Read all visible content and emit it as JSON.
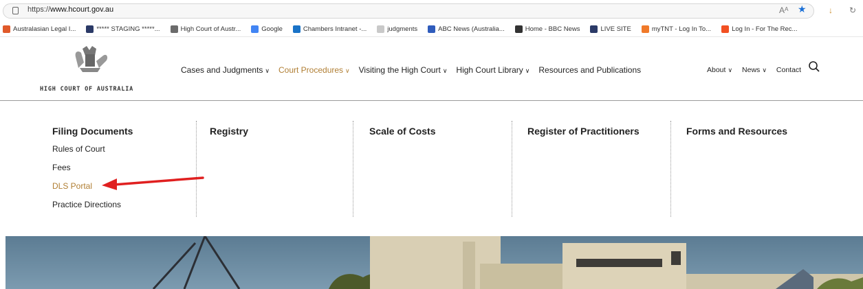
{
  "browser": {
    "url_prefix": "https://",
    "url_host": "www.hcourt.gov.au"
  },
  "bookmarks": [
    {
      "label": "Australasian Legal I...",
      "color": "#e05a2a"
    },
    {
      "label": "***** STAGING *****...",
      "color": "#2b3a67"
    },
    {
      "label": "High Court of Austr...",
      "color": "#6b6b6b"
    },
    {
      "label": "Google",
      "color": "#4285f4"
    },
    {
      "label": "Chambers Intranet -...",
      "color": "#1a73c7"
    },
    {
      "label": "judgments",
      "color": "#c9c9c9"
    },
    {
      "label": "ABC News (Australia...",
      "color": "#2f5cbc"
    },
    {
      "label": "Home - BBC News",
      "color": "#333333"
    },
    {
      "label": "LIVE SITE",
      "color": "#2b3a67"
    },
    {
      "label": "myTNT - Log In To...",
      "color": "#f07a2a"
    },
    {
      "label": "Log In - For The Rec...",
      "color": "#f25022"
    }
  ],
  "site": {
    "org_name": "HIGH COURT OF AUSTRALIA",
    "main_nav": [
      {
        "label": "Cases and Judgments",
        "active": false
      },
      {
        "label": "Court Procedures",
        "active": true
      },
      {
        "label": "Visiting the High Court",
        "active": false
      },
      {
        "label": "High Court Library",
        "active": false
      },
      {
        "label": "Resources and Publications",
        "active": false
      }
    ],
    "util_nav": [
      "About",
      "News",
      "Contact"
    ]
  },
  "mega_menu": {
    "columns": [
      {
        "heading": "Filing Documents",
        "links": [
          "Rules of Court",
          "Fees",
          "DLS Portal",
          "Practice Directions"
        ]
      },
      {
        "heading": "Registry",
        "links": []
      },
      {
        "heading": "Scale of Costs",
        "links": []
      },
      {
        "heading": "Register of Practitioners",
        "links": []
      },
      {
        "heading": "Forms and Resources",
        "links": []
      }
    ],
    "highlighted_link": "DLS Portal"
  },
  "colors": {
    "accent": "#b07e33",
    "annotation_arrow": "#e02020"
  }
}
